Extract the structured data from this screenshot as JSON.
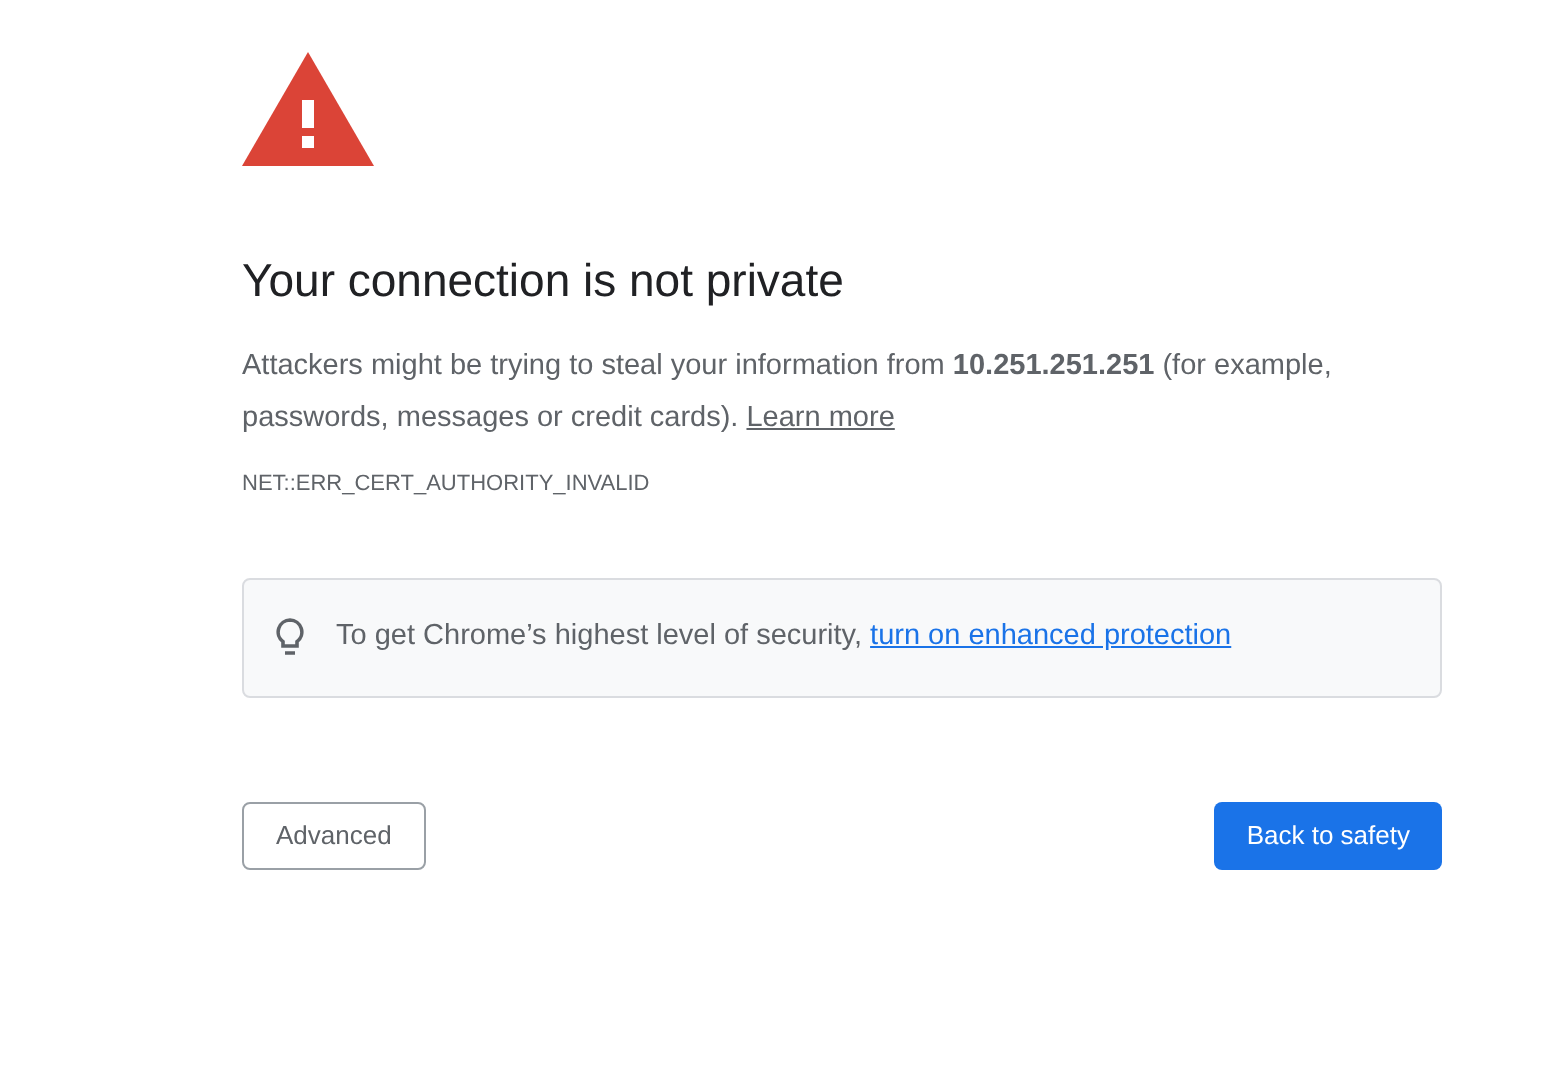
{
  "heading": "Your connection is not private",
  "message": {
    "text": "Attackers might be trying to steal your information from **10.251.251.251** (for example, passwords, messages or credit cards).",
    "link": "Learn more"
  },
  "error_code": "NET::ERR_CERT_AUTHORITY_INVALID",
  "tip": {
    "text": "To get Chrome’s highest level of security,",
    "link": "turn on enhanced protection"
  },
  "buttons": [
    {
      "label": "Advanced",
      "kind": "secondary"
    },
    {
      "label": "Back to safety",
      "kind": "primary"
    }
  ]
}
